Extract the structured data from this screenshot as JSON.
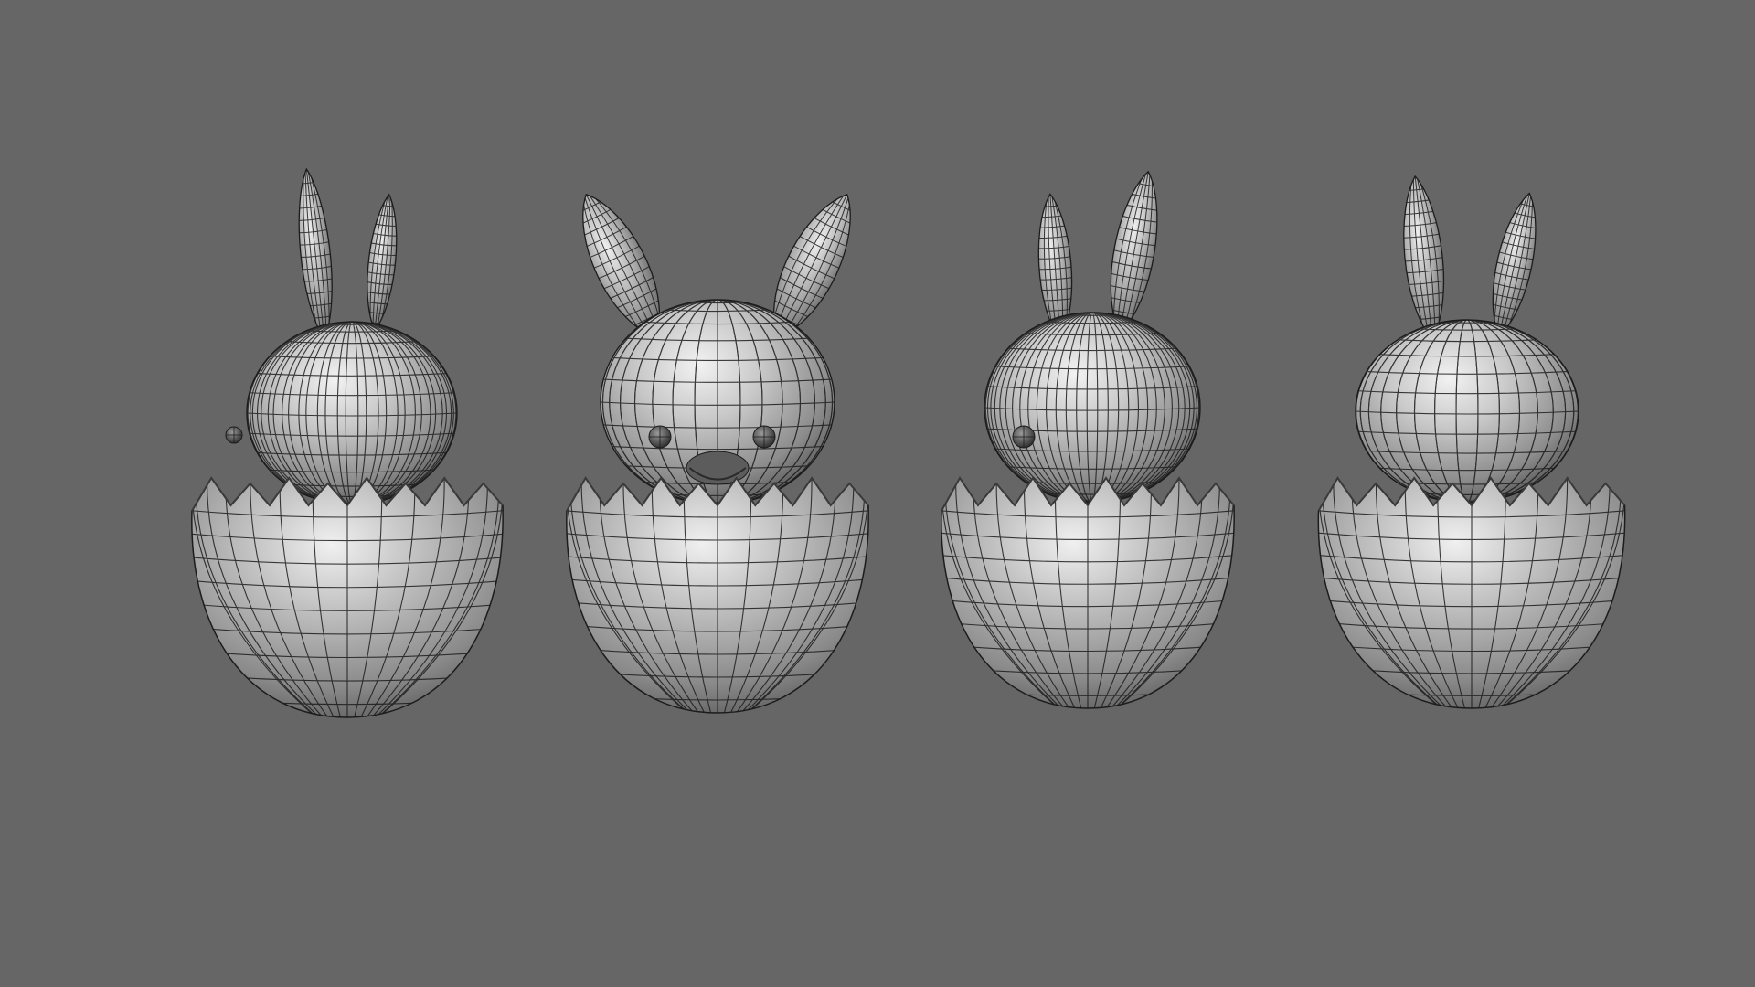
{
  "viewport": {
    "background": "#666666",
    "shading": "smooth-shaded-with-wireframe",
    "wire_color": "#1c1c1c"
  },
  "models": [
    {
      "name": "bunny-in-egg",
      "view": "three-quarter-left"
    },
    {
      "name": "bunny-in-egg",
      "view": "front"
    },
    {
      "name": "bunny-in-egg",
      "view": "three-quarter-left-2"
    },
    {
      "name": "bunny-in-egg",
      "view": "back"
    }
  ]
}
